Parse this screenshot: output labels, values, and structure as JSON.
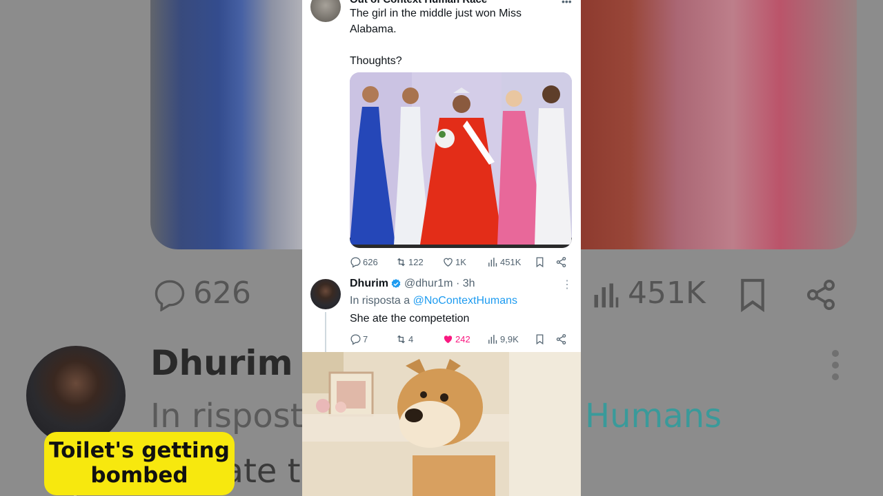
{
  "background": {
    "reply_count": "626",
    "view_count": "451K",
    "author_name": "Dhurim",
    "reply_prefix": "In rispost",
    "reply_mention": "Humans",
    "body_fragment": "She ate t"
  },
  "tweet": {
    "author_name": "Out of Context Human Race",
    "text_line1": "The girl in the middle just won Miss Alabama.",
    "text_line2": "Thoughts?",
    "media_icon": "pageant-photo",
    "stats": {
      "replies": "626",
      "retweets": "122",
      "likes": "1K",
      "views": "451K"
    }
  },
  "reply": {
    "author_name": "Dhurim",
    "handle_time": "@dhur1m · 3h",
    "reply_to_label": "In risposta a",
    "reply_to_mention": "@NoContextHumans",
    "text": "She ate the competetion",
    "stats": {
      "replies": "7",
      "retweets": "4",
      "likes": "242",
      "views": "9,9K"
    }
  },
  "meme": {
    "caption_line1": "Toilet's getting",
    "caption_line2": "bombed",
    "caption_bg": "#f7e80e"
  },
  "colors": {
    "like_pink": "#f91880",
    "link_blue": "#1d9bf0",
    "muted": "#536471"
  },
  "icons": [
    "reply-icon",
    "retweet-icon",
    "heart-icon",
    "views-icon",
    "bookmark-icon",
    "share-icon",
    "verified-badge-icon",
    "more-icon"
  ]
}
